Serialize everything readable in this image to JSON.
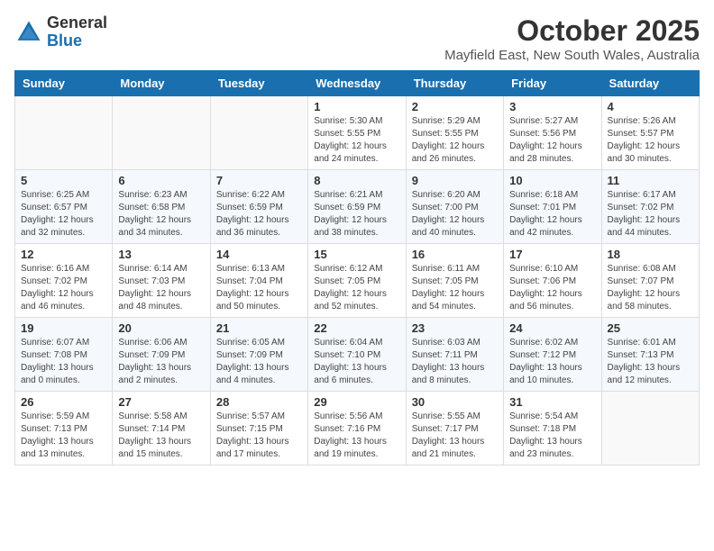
{
  "header": {
    "logo_general": "General",
    "logo_blue": "Blue",
    "month_year": "October 2025",
    "location": "Mayfield East, New South Wales, Australia"
  },
  "weekdays": [
    "Sunday",
    "Monday",
    "Tuesday",
    "Wednesday",
    "Thursday",
    "Friday",
    "Saturday"
  ],
  "weeks": [
    [
      {
        "day": "",
        "info": ""
      },
      {
        "day": "",
        "info": ""
      },
      {
        "day": "",
        "info": ""
      },
      {
        "day": "1",
        "info": "Sunrise: 5:30 AM\nSunset: 5:55 PM\nDaylight: 12 hours and 24 minutes."
      },
      {
        "day": "2",
        "info": "Sunrise: 5:29 AM\nSunset: 5:55 PM\nDaylight: 12 hours and 26 minutes."
      },
      {
        "day": "3",
        "info": "Sunrise: 5:27 AM\nSunset: 5:56 PM\nDaylight: 12 hours and 28 minutes."
      },
      {
        "day": "4",
        "info": "Sunrise: 5:26 AM\nSunset: 5:57 PM\nDaylight: 12 hours and 30 minutes."
      }
    ],
    [
      {
        "day": "5",
        "info": "Sunrise: 6:25 AM\nSunset: 6:57 PM\nDaylight: 12 hours and 32 minutes."
      },
      {
        "day": "6",
        "info": "Sunrise: 6:23 AM\nSunset: 6:58 PM\nDaylight: 12 hours and 34 minutes."
      },
      {
        "day": "7",
        "info": "Sunrise: 6:22 AM\nSunset: 6:59 PM\nDaylight: 12 hours and 36 minutes."
      },
      {
        "day": "8",
        "info": "Sunrise: 6:21 AM\nSunset: 6:59 PM\nDaylight: 12 hours and 38 minutes."
      },
      {
        "day": "9",
        "info": "Sunrise: 6:20 AM\nSunset: 7:00 PM\nDaylight: 12 hours and 40 minutes."
      },
      {
        "day": "10",
        "info": "Sunrise: 6:18 AM\nSunset: 7:01 PM\nDaylight: 12 hours and 42 minutes."
      },
      {
        "day": "11",
        "info": "Sunrise: 6:17 AM\nSunset: 7:02 PM\nDaylight: 12 hours and 44 minutes."
      }
    ],
    [
      {
        "day": "12",
        "info": "Sunrise: 6:16 AM\nSunset: 7:02 PM\nDaylight: 12 hours and 46 minutes."
      },
      {
        "day": "13",
        "info": "Sunrise: 6:14 AM\nSunset: 7:03 PM\nDaylight: 12 hours and 48 minutes."
      },
      {
        "day": "14",
        "info": "Sunrise: 6:13 AM\nSunset: 7:04 PM\nDaylight: 12 hours and 50 minutes."
      },
      {
        "day": "15",
        "info": "Sunrise: 6:12 AM\nSunset: 7:05 PM\nDaylight: 12 hours and 52 minutes."
      },
      {
        "day": "16",
        "info": "Sunrise: 6:11 AM\nSunset: 7:05 PM\nDaylight: 12 hours and 54 minutes."
      },
      {
        "day": "17",
        "info": "Sunrise: 6:10 AM\nSunset: 7:06 PM\nDaylight: 12 hours and 56 minutes."
      },
      {
        "day": "18",
        "info": "Sunrise: 6:08 AM\nSunset: 7:07 PM\nDaylight: 12 hours and 58 minutes."
      }
    ],
    [
      {
        "day": "19",
        "info": "Sunrise: 6:07 AM\nSunset: 7:08 PM\nDaylight: 13 hours and 0 minutes."
      },
      {
        "day": "20",
        "info": "Sunrise: 6:06 AM\nSunset: 7:09 PM\nDaylight: 13 hours and 2 minutes."
      },
      {
        "day": "21",
        "info": "Sunrise: 6:05 AM\nSunset: 7:09 PM\nDaylight: 13 hours and 4 minutes."
      },
      {
        "day": "22",
        "info": "Sunrise: 6:04 AM\nSunset: 7:10 PM\nDaylight: 13 hours and 6 minutes."
      },
      {
        "day": "23",
        "info": "Sunrise: 6:03 AM\nSunset: 7:11 PM\nDaylight: 13 hours and 8 minutes."
      },
      {
        "day": "24",
        "info": "Sunrise: 6:02 AM\nSunset: 7:12 PM\nDaylight: 13 hours and 10 minutes."
      },
      {
        "day": "25",
        "info": "Sunrise: 6:01 AM\nSunset: 7:13 PM\nDaylight: 13 hours and 12 minutes."
      }
    ],
    [
      {
        "day": "26",
        "info": "Sunrise: 5:59 AM\nSunset: 7:13 PM\nDaylight: 13 hours and 13 minutes."
      },
      {
        "day": "27",
        "info": "Sunrise: 5:58 AM\nSunset: 7:14 PM\nDaylight: 13 hours and 15 minutes."
      },
      {
        "day": "28",
        "info": "Sunrise: 5:57 AM\nSunset: 7:15 PM\nDaylight: 13 hours and 17 minutes."
      },
      {
        "day": "29",
        "info": "Sunrise: 5:56 AM\nSunset: 7:16 PM\nDaylight: 13 hours and 19 minutes."
      },
      {
        "day": "30",
        "info": "Sunrise: 5:55 AM\nSunset: 7:17 PM\nDaylight: 13 hours and 21 minutes."
      },
      {
        "day": "31",
        "info": "Sunrise: 5:54 AM\nSunset: 7:18 PM\nDaylight: 13 hours and 23 minutes."
      },
      {
        "day": "",
        "info": ""
      }
    ]
  ]
}
